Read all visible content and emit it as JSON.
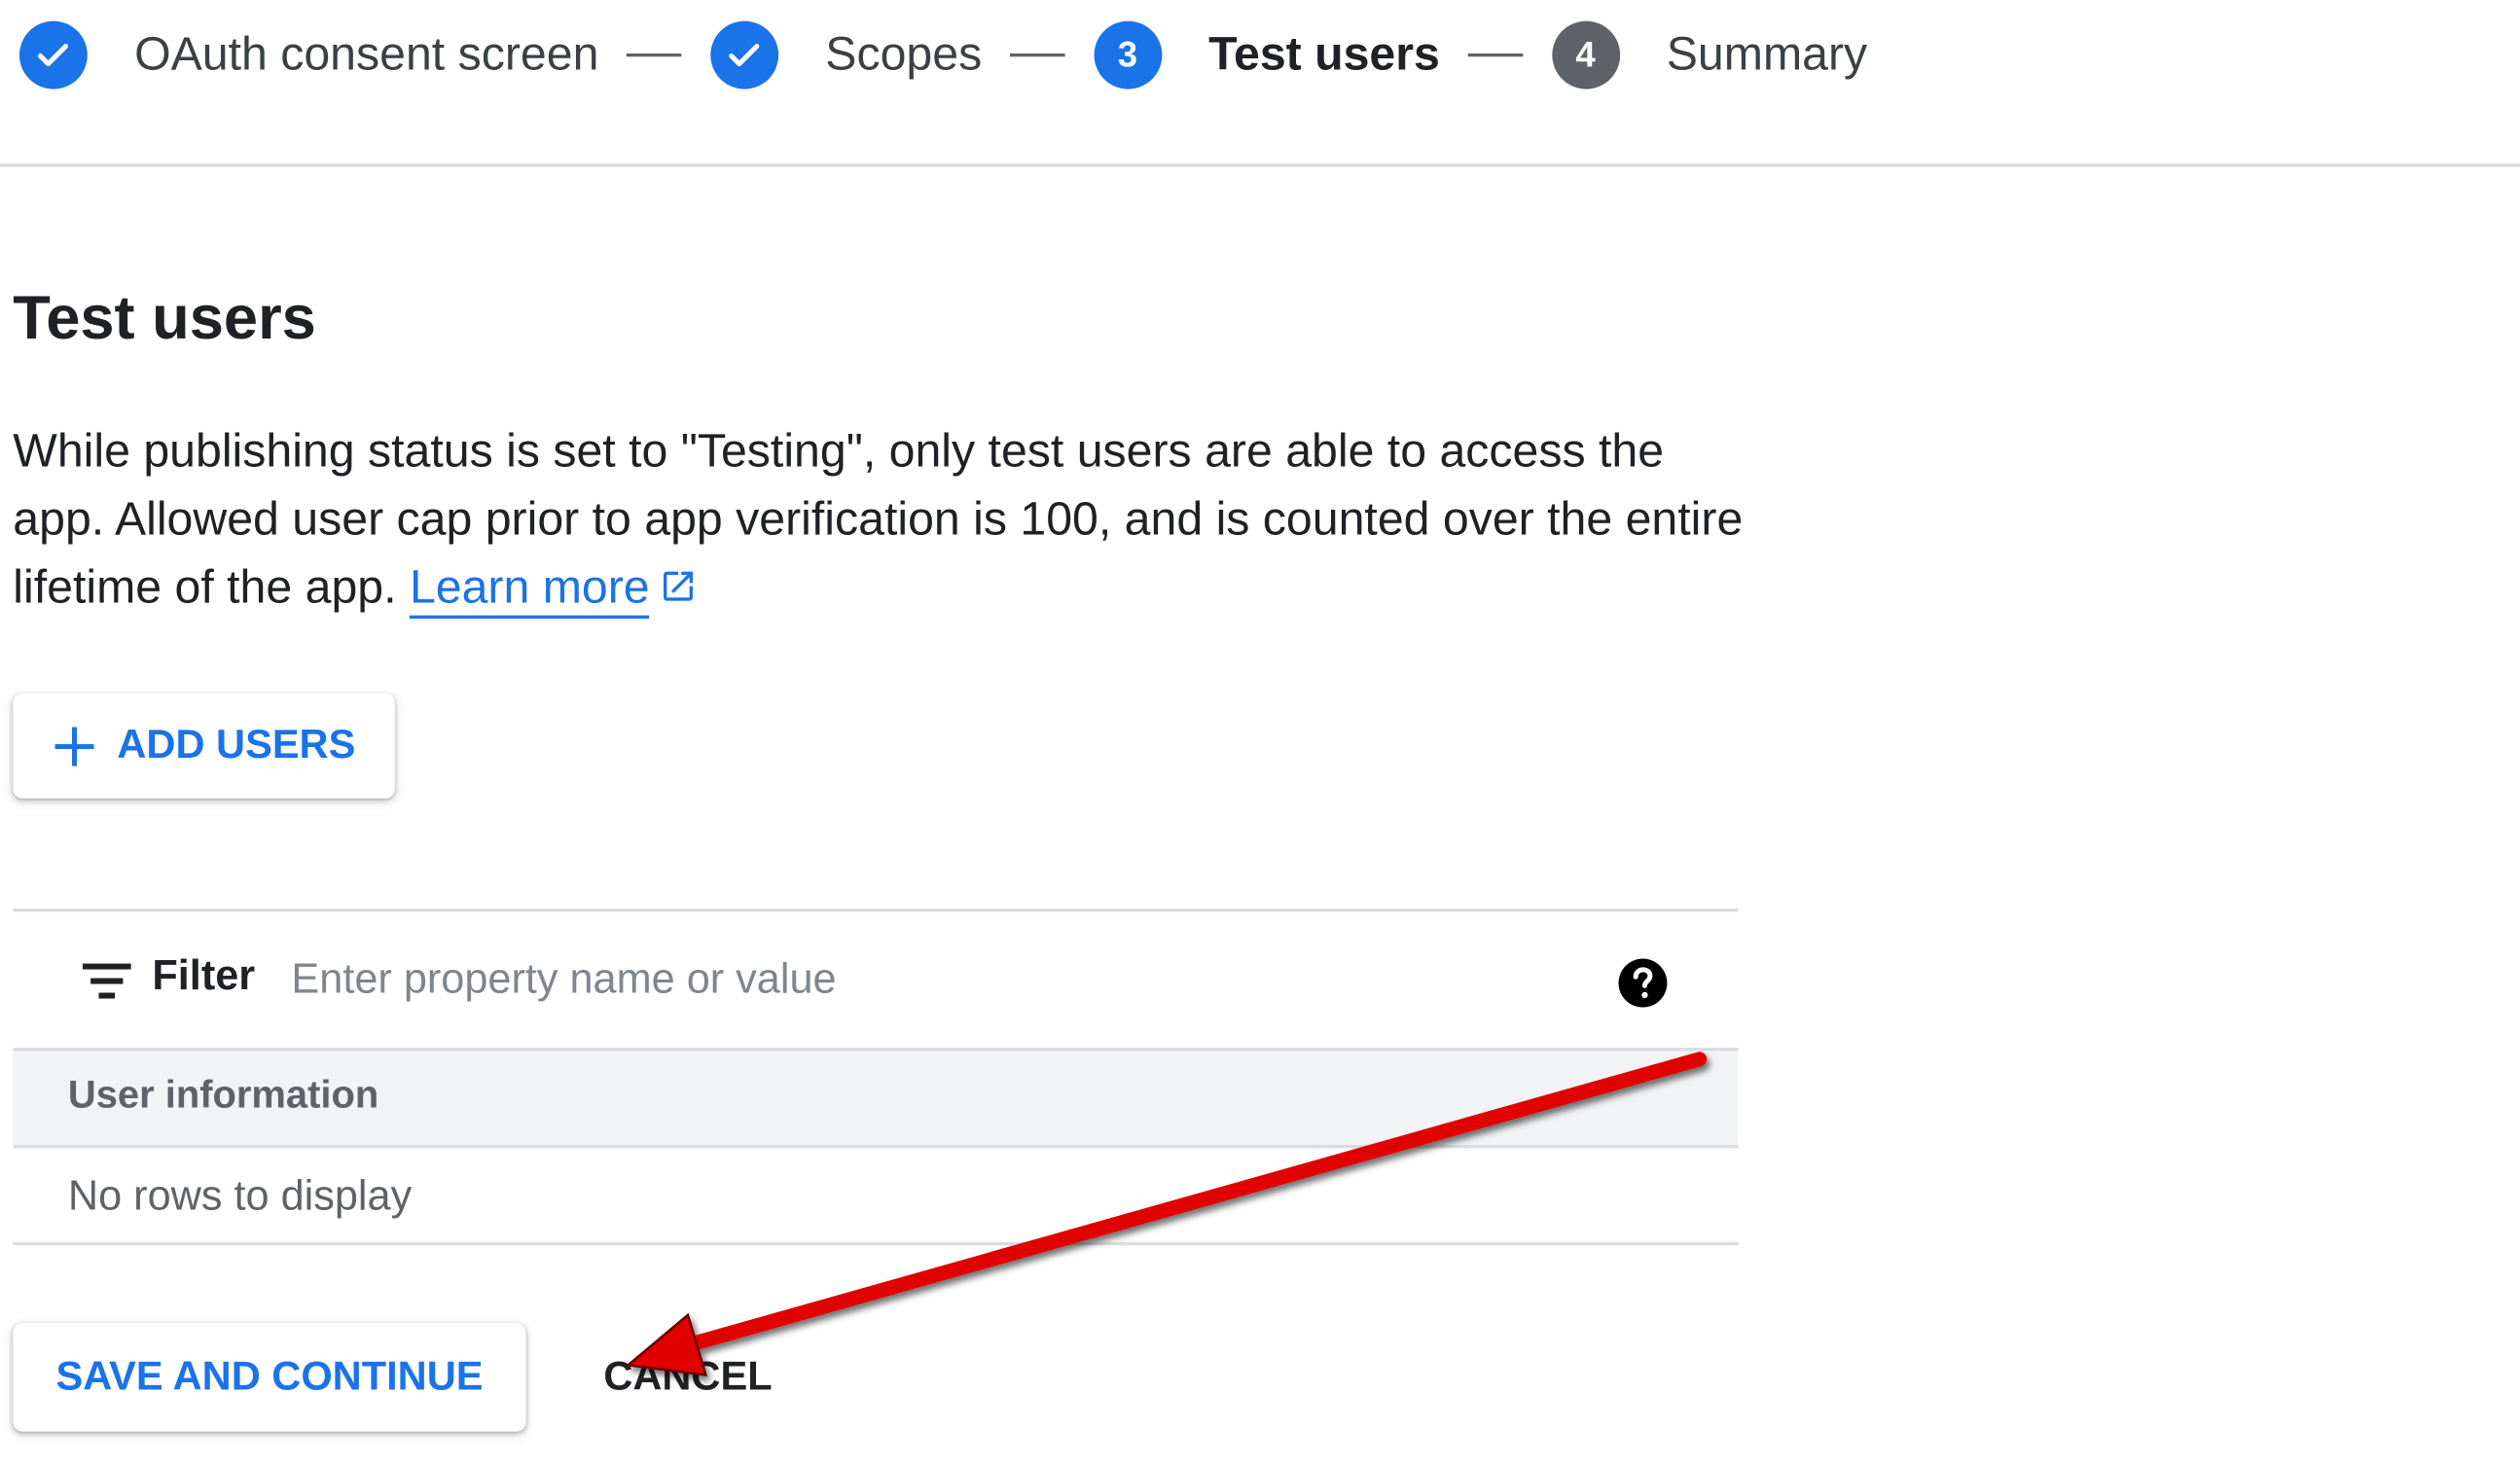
{
  "stepper": {
    "steps": [
      {
        "label": "OAuth consent screen",
        "status": "done"
      },
      {
        "label": "Scopes",
        "status": "done"
      },
      {
        "label": "Test users",
        "status": "current",
        "number": "3"
      },
      {
        "label": "Summary",
        "status": "pending",
        "number": "4"
      }
    ]
  },
  "section": {
    "title": "Test users",
    "description": "While publishing status is set to \"Testing\", only test users are able to access the app. Allowed user cap prior to app verification is 100, and is counted over the entire lifetime of the app.",
    "learn_more": "Learn more"
  },
  "add_users_button": {
    "label": "ADD USERS"
  },
  "table": {
    "filter_label": "Filter",
    "filter_placeholder": "Enter property name or value",
    "columns": [
      "User information"
    ],
    "empty_message": "No rows to display"
  },
  "actions": {
    "save_label": "SAVE AND CONTINUE",
    "cancel_label": "CANCEL"
  },
  "colors": {
    "accent": "#1a73e8",
    "pending_step": "#5f6368",
    "annotation_arrow": "#e00000"
  },
  "icons": [
    "check-icon",
    "plus-icon",
    "filter-icon",
    "help-icon",
    "external-link-icon"
  ]
}
